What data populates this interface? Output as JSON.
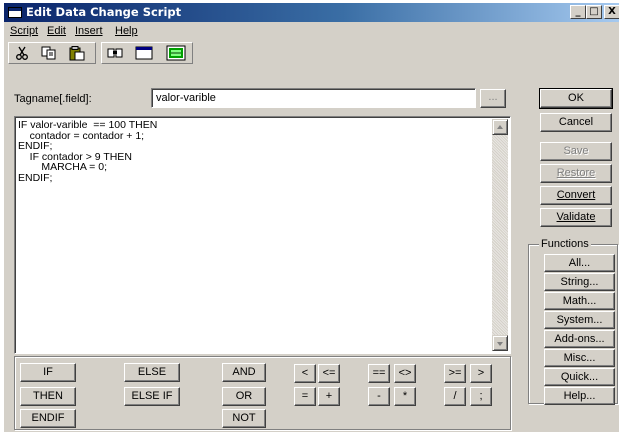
{
  "window": {
    "title": "Edit Data Change Script",
    "caption_buttons": {
      "minimize": "_",
      "maximize": "□",
      "close": "X"
    }
  },
  "menu": [
    "Script",
    "Edit",
    "Insert",
    "Help"
  ],
  "toolbar": {
    "icons": [
      "cut-icon",
      "copy-icon",
      "paste-icon",
      "find-icon",
      "window-icon",
      "convert-icon"
    ]
  },
  "tagname": {
    "label": "Tagname[.field]:",
    "value": "valor-varible",
    "browse_label": "..."
  },
  "script": {
    "lines": [
      "IF valor-varible  == 100 THEN",
      "    contador = contador + 1;",
      "ENDIF;",
      "    IF contador > 9 THEN",
      "        MARCHA = 0;",
      "ENDIF;"
    ]
  },
  "side_buttons": {
    "ok": "OK",
    "cancel": "Cancel",
    "save": "Save",
    "restore": "Restore",
    "convert": "Convert",
    "validate": "Validate"
  },
  "functions": {
    "label": "Functions",
    "buttons": [
      "All...",
      "String...",
      "Math...",
      "System...",
      "Add-ons...",
      "Misc...",
      "Quick...",
      "Help..."
    ]
  },
  "keywords": {
    "if": "IF",
    "then": "THEN",
    "endif": "ENDIF",
    "else": "ELSE",
    "else_if": "ELSE IF",
    "and": "AND",
    "or": "OR",
    "not": "NOT"
  },
  "operators": {
    "lt": "<",
    "le": "<=",
    "eq": "==",
    "ne": "<>",
    "ge": ">=",
    "gt": ">",
    "assign": "=",
    "plus": "+",
    "minus": "-",
    "mult": "*",
    "div": "/",
    "semicolon": ";"
  }
}
